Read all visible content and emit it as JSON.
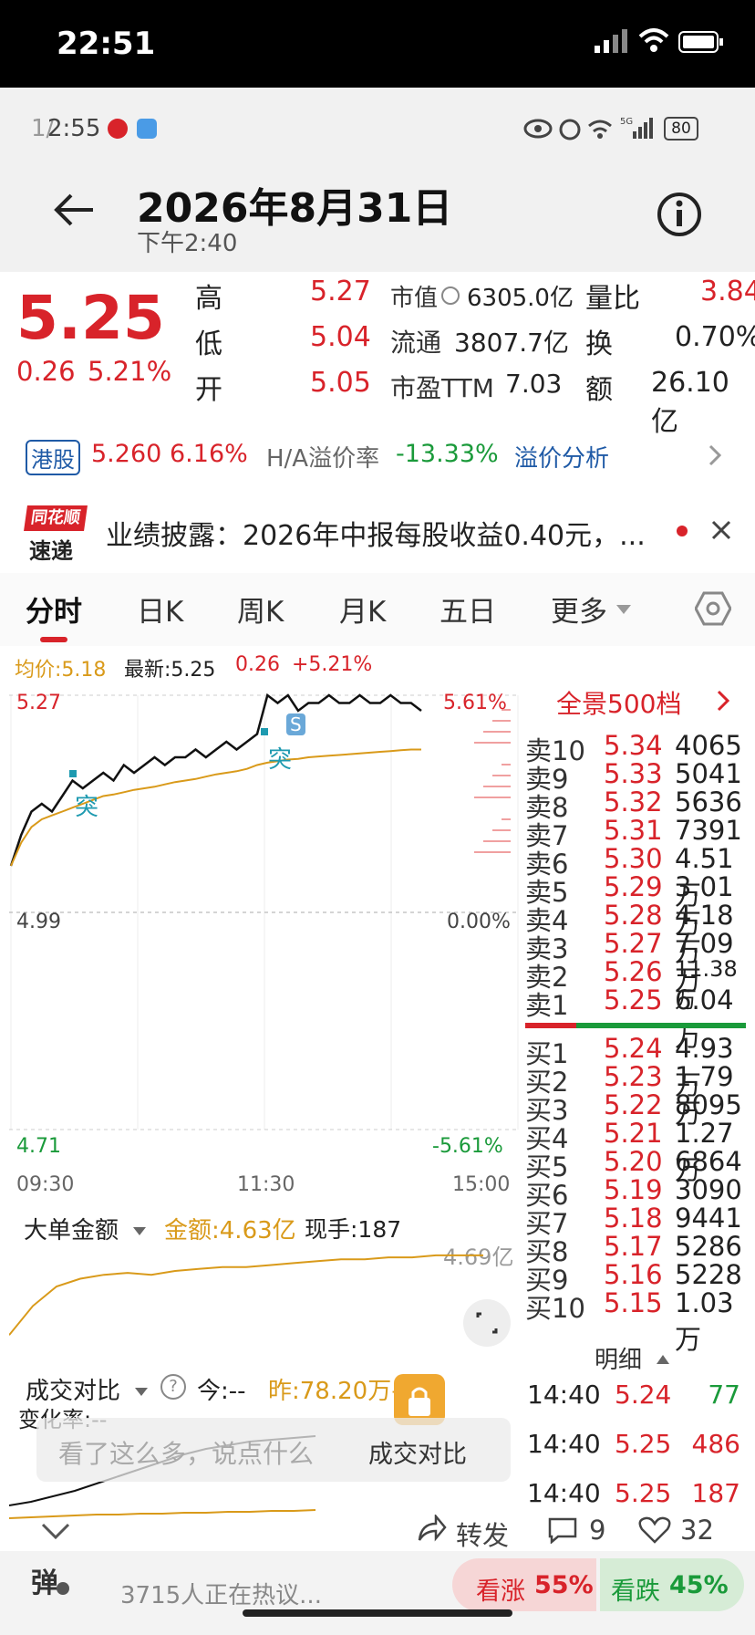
{
  "outer_status": {
    "time": "22:51"
  },
  "inner_status": {
    "time": "2:55",
    "page": "1/",
    "battery": "80"
  },
  "header": {
    "date": "2026年8月31日",
    "time": "下午2:40"
  },
  "quote": {
    "price": "5.25",
    "change": "0.26",
    "change_pct": "5.21%",
    "high_label": "高",
    "high": "5.27",
    "low_label": "低",
    "low": "5.04",
    "open_label": "开",
    "open": "5.05",
    "mktcap_label": "市值",
    "mktcap": "6305.0亿",
    "float_label": "流通",
    "float": "3807.7亿",
    "pe_label": "市盈TTM",
    "pe": "7.03",
    "vr_label": "量比",
    "vr": "3.84",
    "turnover_label": "换",
    "turnover": "0.70%",
    "amount_label": "额",
    "amount": "26.10亿"
  },
  "hk": {
    "tag": "港股",
    "price": "5.260",
    "pct": "6.16%",
    "premium_label": "H/A溢价率",
    "premium": "-13.33%",
    "link": "溢价分析"
  },
  "news": {
    "logo_top": "同花顺",
    "logo_bottom": "速递",
    "text": "业绩披露：2026年中报每股收益0.40元，..."
  },
  "tabs": [
    "分时",
    "日K",
    "周K",
    "月K",
    "五日",
    "更多"
  ],
  "chart_info": {
    "avg": "均价:5.18",
    "latest": "最新:5.25",
    "chg": "0.26",
    "pct": "+5.21%"
  },
  "chart_data": {
    "type": "line",
    "ylim": [
      4.71,
      5.27
    ],
    "y_labels_left": [
      "5.27",
      "4.99",
      "4.71"
    ],
    "y_labels_right": [
      "5.61%",
      "0.00%",
      "-5.61%"
    ],
    "x_labels": [
      "09:30",
      "11:30",
      "15:00"
    ],
    "series": [
      {
        "values": [
          5.05,
          5.09,
          5.12,
          5.13,
          5.12,
          5.14,
          5.16,
          5.15,
          5.16,
          5.17,
          5.16,
          5.18,
          5.17,
          5.18,
          5.19,
          5.18,
          5.19,
          5.19,
          5.2,
          5.19,
          5.2,
          5.21,
          5.2,
          5.21,
          5.22,
          5.27,
          5.26,
          5.27,
          5.25,
          5.26,
          5.26,
          5.27,
          5.26,
          5.26,
          5.27,
          5.26,
          5.26,
          5.27,
          5.26,
          5.26,
          5.25
        ]
      },
      {
        "values": [
          5.05,
          5.08,
          5.1,
          5.11,
          5.115,
          5.12,
          5.125,
          5.13,
          5.135,
          5.14,
          5.142,
          5.145,
          5.148,
          5.15,
          5.152,
          5.155,
          5.158,
          5.16,
          5.162,
          5.165,
          5.168,
          5.17,
          5.172,
          5.175,
          5.18,
          5.183,
          5.185,
          5.187,
          5.188,
          5.19,
          5.191,
          5.192,
          5.193,
          5.194,
          5.195,
          5.196,
          5.197,
          5.198,
          5.199,
          5.2,
          5.2
        ]
      }
    ]
  },
  "chart_marks": {
    "tu": "突",
    "s": "S"
  },
  "big_order": {
    "label": "大单金额",
    "amount": "金额:4.63亿",
    "hand": "现手:187",
    "max": "4.69亿"
  },
  "compare": {
    "label": "成交对比",
    "today": "今:--",
    "yest": "昨:78.20万手",
    "rate": "变化率:--",
    "overlay": "成交对比"
  },
  "orderbook": {
    "header": "全景500档",
    "asks": [
      {
        "label": "卖10",
        "price": "5.34",
        "vol": "4065"
      },
      {
        "label": "卖9",
        "price": "5.33",
        "vol": "5041"
      },
      {
        "label": "卖8",
        "price": "5.32",
        "vol": "5636"
      },
      {
        "label": "卖7",
        "price": "5.31",
        "vol": "7391"
      },
      {
        "label": "卖6",
        "price": "5.30",
        "vol": "4.51万"
      },
      {
        "label": "卖5",
        "price": "5.29",
        "vol": "3.01万"
      },
      {
        "label": "卖4",
        "price": "5.28",
        "vol": "4.18万"
      },
      {
        "label": "卖3",
        "price": "5.27",
        "vol": "7.09万"
      },
      {
        "label": "卖2",
        "price": "5.26",
        "vol": "11.38万"
      },
      {
        "label": "卖1",
        "price": "5.25",
        "vol": "6.04万"
      }
    ],
    "bids": [
      {
        "label": "买1",
        "price": "5.24",
        "vol": "4.93万"
      },
      {
        "label": "买2",
        "price": "5.23",
        "vol": "1.79万"
      },
      {
        "label": "买3",
        "price": "5.22",
        "vol": "8095"
      },
      {
        "label": "买4",
        "price": "5.21",
        "vol": "1.27万"
      },
      {
        "label": "买5",
        "price": "5.20",
        "vol": "6864"
      },
      {
        "label": "买6",
        "price": "5.19",
        "vol": "3090"
      },
      {
        "label": "买7",
        "price": "5.18",
        "vol": "9441"
      },
      {
        "label": "买8",
        "price": "5.17",
        "vol": "5286"
      },
      {
        "label": "买9",
        "price": "5.16",
        "vol": "5228"
      },
      {
        "label": "买10",
        "price": "5.15",
        "vol": "1.03万"
      }
    ]
  },
  "ticks": {
    "header": "明细",
    "rows": [
      {
        "time": "14:40",
        "price": "5.24",
        "vol": "77"
      },
      {
        "time": "14:40",
        "price": "5.25",
        "vol": "486"
      },
      {
        "time": "14:40",
        "price": "5.25",
        "vol": "187"
      }
    ]
  },
  "comment": {
    "placeholder": "看了这么多，说点什么",
    "danmu": "弹",
    "discuss": "3715人正在热议..."
  },
  "actions": {
    "share": "转发",
    "comments": "9",
    "likes": "32"
  },
  "vote": {
    "up_label": "看涨",
    "up_pct": "55%",
    "down_label": "看跌",
    "down_pct": "45%"
  },
  "colors": {
    "up": "#d8232a",
    "down": "#1a9a3a",
    "avg_line": "#d99a1a"
  }
}
